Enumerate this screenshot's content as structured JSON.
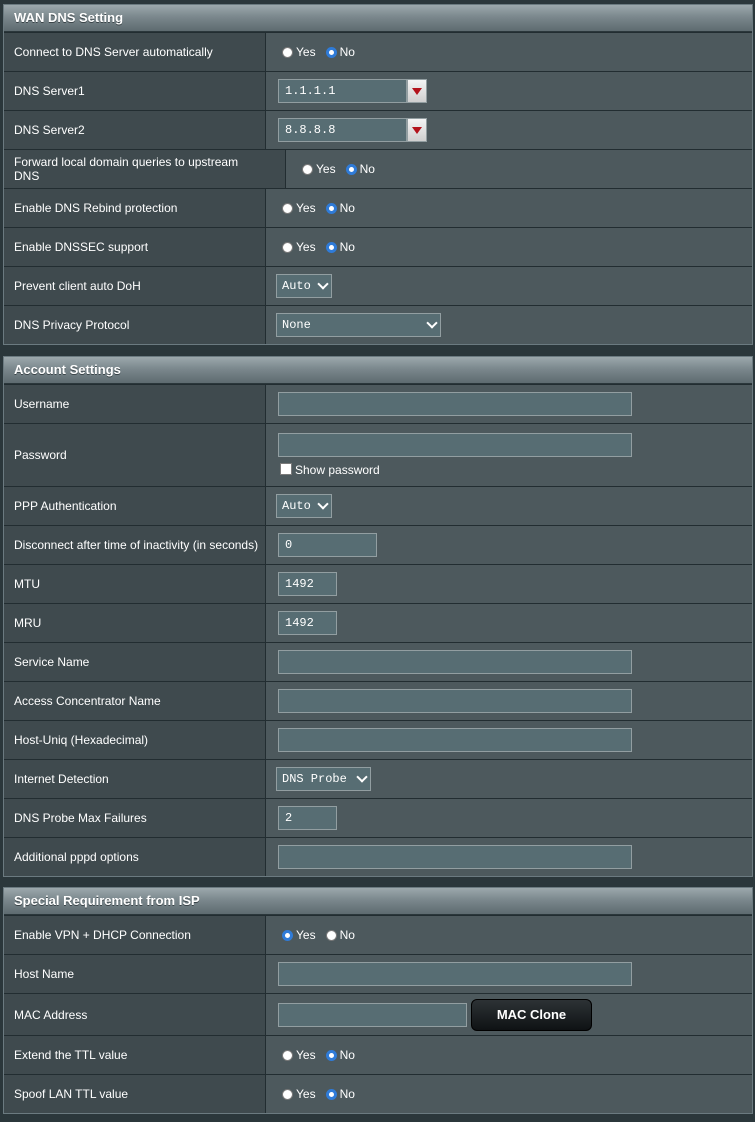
{
  "wan_dns": {
    "title": "WAN DNS Setting",
    "connect_auto": {
      "label": "Connect to DNS Server automatically",
      "yes": "Yes",
      "no": "No",
      "selected": "No"
    },
    "dns1": {
      "label": "DNS Server1",
      "value": "1.1.1.1"
    },
    "dns2": {
      "label": "DNS Server2",
      "value": "8.8.8.8"
    },
    "forward_local": {
      "label": "Forward local domain queries to upstream DNS",
      "yes": "Yes",
      "no": "No",
      "selected": "No"
    },
    "rebind": {
      "label": "Enable DNS Rebind protection",
      "yes": "Yes",
      "no": "No",
      "selected": "No"
    },
    "dnssec": {
      "label": "Enable DNSSEC support",
      "yes": "Yes",
      "no": "No",
      "selected": "No"
    },
    "auto_doh": {
      "label": "Prevent client auto DoH",
      "value": "Auto"
    },
    "privacy": {
      "label": "DNS Privacy Protocol",
      "value": "None"
    }
  },
  "account": {
    "title": "Account Settings",
    "username": {
      "label": "Username",
      "value": ""
    },
    "password": {
      "label": "Password",
      "value": "",
      "show_label": "Show password",
      "show_checked": false
    },
    "ppp_auth": {
      "label": "PPP Authentication",
      "value": "Auto"
    },
    "idle": {
      "label": "Disconnect after time of inactivity (in seconds)",
      "value": "0"
    },
    "mtu": {
      "label": "MTU",
      "value": "1492"
    },
    "mru": {
      "label": "MRU",
      "value": "1492"
    },
    "service": {
      "label": "Service Name",
      "value": ""
    },
    "ac_name": {
      "label": "Access Concentrator Name",
      "value": ""
    },
    "host_uniq": {
      "label": "Host-Uniq (Hexadecimal)",
      "value": ""
    },
    "detection": {
      "label": "Internet Detection",
      "value": "DNS Probe"
    },
    "probe_max": {
      "label": "DNS Probe Max Failures",
      "value": "2"
    },
    "pppd_opts": {
      "label": "Additional pppd options",
      "value": ""
    }
  },
  "isp": {
    "title": "Special Requirement from ISP",
    "vpn_dhcp": {
      "label": "Enable VPN + DHCP Connection",
      "yes": "Yes",
      "no": "No",
      "selected": "Yes"
    },
    "host_name": {
      "label": "Host Name",
      "value": ""
    },
    "mac": {
      "label": "MAC Address",
      "value": "",
      "clone_label": "MAC Clone"
    },
    "ttl": {
      "label": "Extend the TTL value",
      "yes": "Yes",
      "no": "No",
      "selected": "No"
    },
    "spoof_ttl": {
      "label": "Spoof LAN TTL value",
      "yes": "Yes",
      "no": "No",
      "selected": "No"
    }
  },
  "colors": {
    "panel": "#4d595d",
    "label_bg": "#3f4a4e",
    "page": "#2b373b",
    "radio_on": "#2f7bd8",
    "arrow": "#b3121b"
  }
}
